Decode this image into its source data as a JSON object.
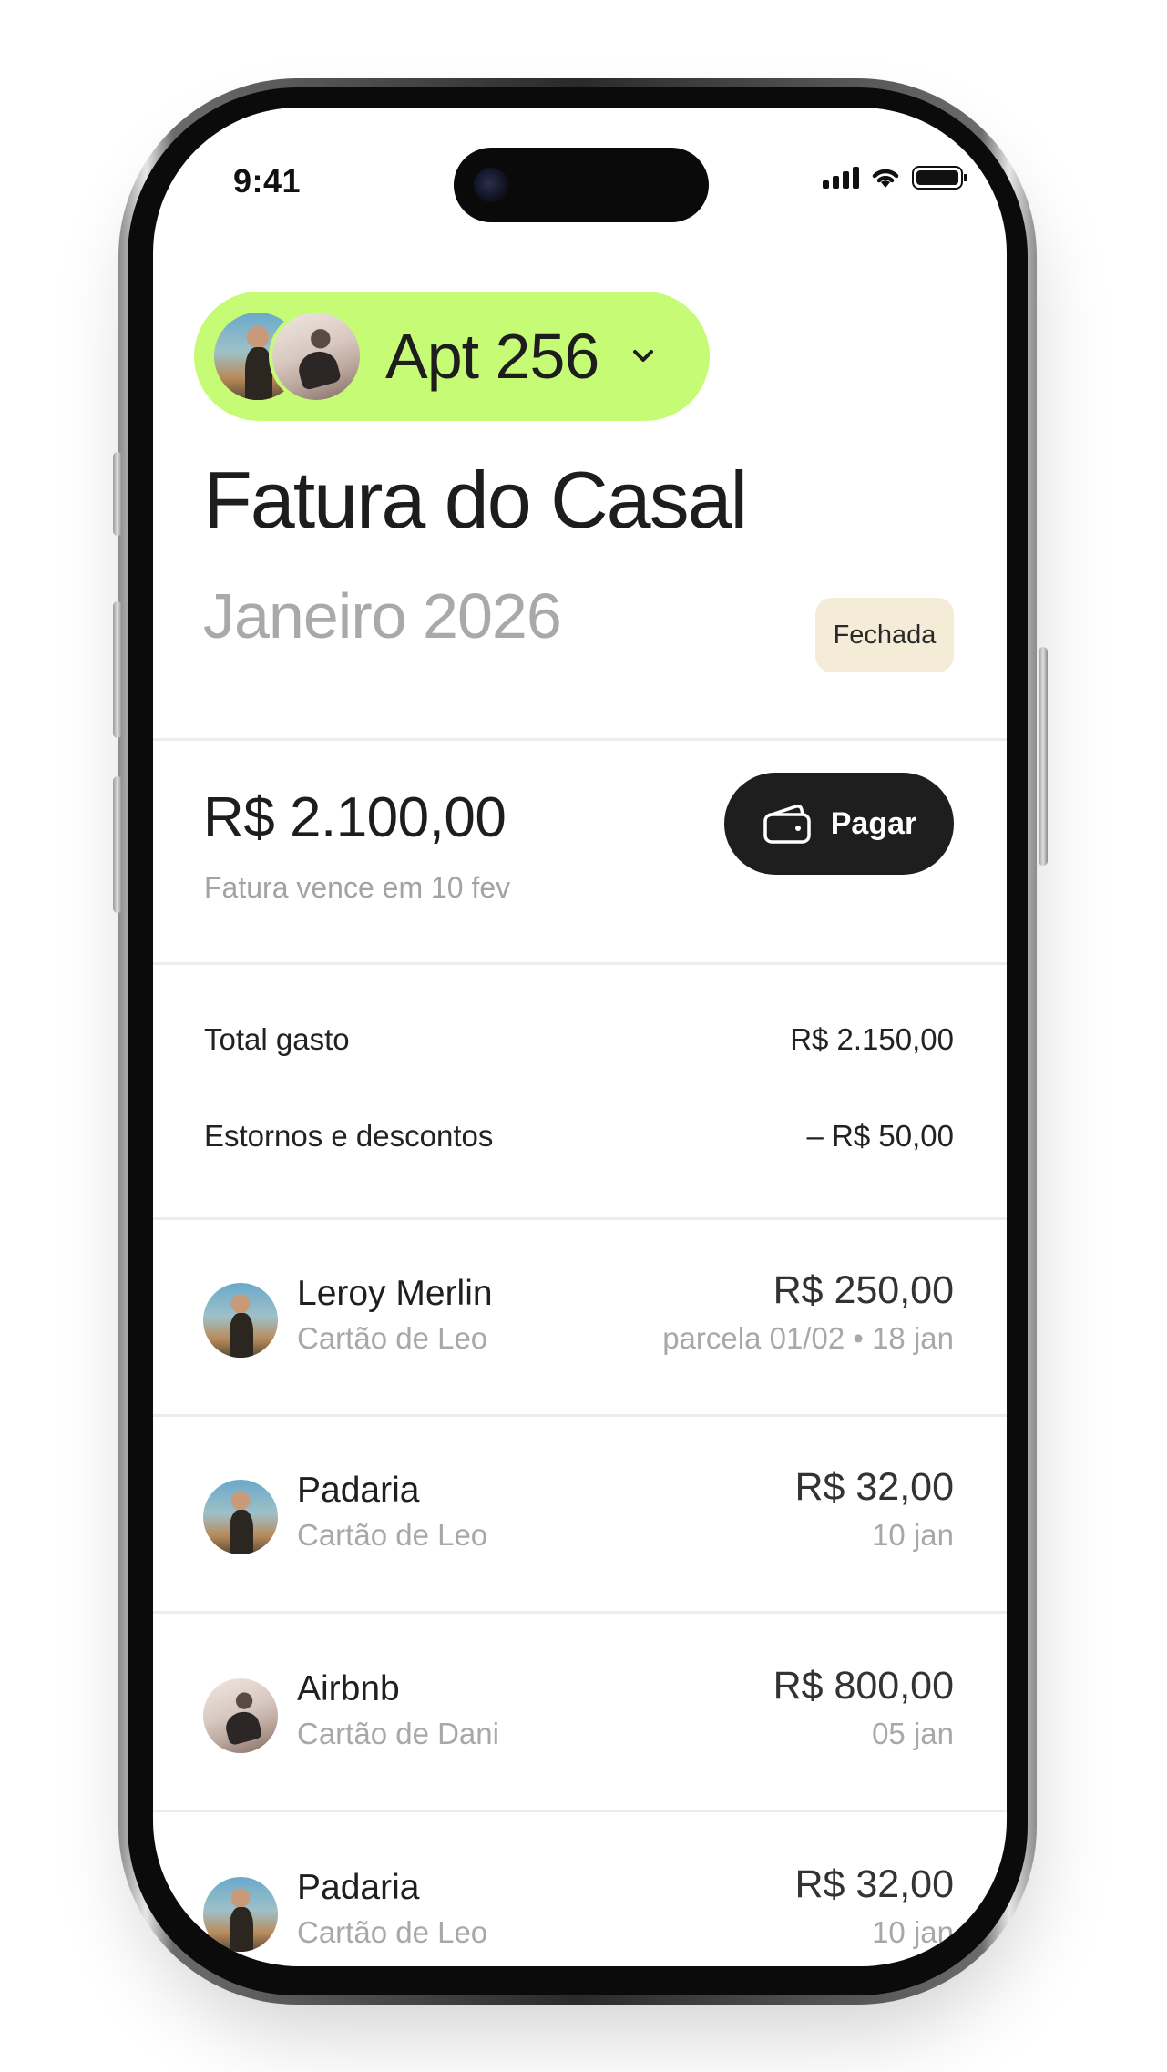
{
  "status_bar": {
    "time": "9:41"
  },
  "group": {
    "name": "Apt 256"
  },
  "header": {
    "title": "Fatura do Casal",
    "period": "Janeiro 2026",
    "status_badge": "Fechada"
  },
  "invoice": {
    "amount": "R$ 2.100,00",
    "due_text": "Fatura vence em 10 fev",
    "pay_label": "Pagar"
  },
  "summary": [
    {
      "label": "Total gasto",
      "value": "R$ 2.150,00"
    },
    {
      "label": "Estornos e descontos",
      "value": "– R$ 50,00"
    }
  ],
  "transactions": [
    {
      "merchant": "Leroy Merlin",
      "card": "Cartão de Leo",
      "amount": "R$ 250,00",
      "meta": "parcela 01/02 • 18 jan",
      "avatar": "leo"
    },
    {
      "merchant": "Padaria",
      "card": "Cartão de Leo",
      "amount": "R$ 32,00",
      "meta": "10 jan",
      "avatar": "leo"
    },
    {
      "merchant": "Airbnb",
      "card": "Cartão de Dani",
      "amount": "R$ 800,00",
      "meta": "05 jan",
      "avatar": "dani"
    },
    {
      "merchant": "Padaria",
      "card": "Cartão de Leo",
      "amount": "R$ 32,00",
      "meta": "10 jan",
      "avatar": "leo"
    }
  ],
  "colors": {
    "group_pill": "#c6fb76",
    "badge": "#f4ecd6",
    "pay_button": "#1e1e1e"
  },
  "icons": {
    "dropdown": "chevron-down-icon",
    "pay": "wallet-icon"
  }
}
